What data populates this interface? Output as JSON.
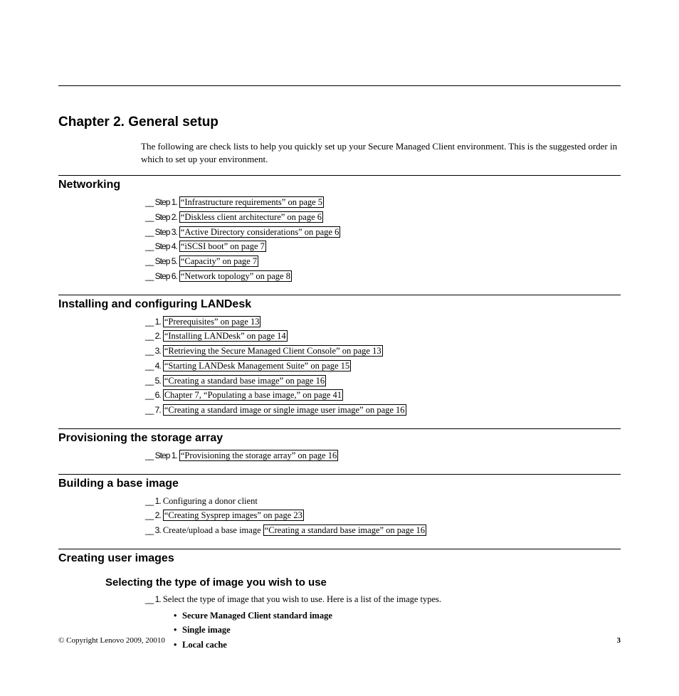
{
  "chapter_title": "Chapter 2. General setup",
  "intro": "The following are check lists to help you quickly set up your Secure Managed Client environment. This is the suggested order in which to set up your environment.",
  "sections": {
    "networking": {
      "heading": "Networking",
      "steps": [
        {
          "prefix": "__ Step 1.",
          "link": "“Infrastructure requirements” on page 5"
        },
        {
          "prefix": "__ Step 2.",
          "link": "“Diskless client architecture” on page 6"
        },
        {
          "prefix": "__ Step 3.",
          "link": "“Active Directory considerations” on page 6"
        },
        {
          "prefix": "__ Step 4.",
          "link": "“iSCSI boot” on page 7"
        },
        {
          "prefix": "__ Step 5.",
          "link": "“Capacity” on page 7"
        },
        {
          "prefix": "__ Step 6.",
          "link": "“Network topology” on page 8"
        }
      ]
    },
    "landesk": {
      "heading": "Installing and configuring LANDesk",
      "steps": [
        {
          "prefix": "__ 1.",
          "link": "“Prerequisites” on page 13"
        },
        {
          "prefix": "__ 2.",
          "link": "“Installing LANDesk” on page 14"
        },
        {
          "prefix": "__ 3.",
          "link": "“Retrieving the Secure Managed Client Console” on page 13"
        },
        {
          "prefix": "__ 4.",
          "link": "“Starting LANDesk Management Suite” on page 15"
        },
        {
          "prefix": "__ 5.",
          "link": "“Creating a standard base image” on page 16"
        },
        {
          "prefix": "__ 6.",
          "link": "Chapter 7, “Populating a base image,” on page 41"
        },
        {
          "prefix": "__ 7.",
          "link": "“Creating a standard image or single image user image” on page 16"
        }
      ]
    },
    "provisioning": {
      "heading": "Provisioning the storage array",
      "steps": [
        {
          "prefix": "__ Step 1.",
          "link": "“Provisioning the storage array” on page 16"
        }
      ]
    },
    "building": {
      "heading": "Building a base image",
      "steps": [
        {
          "prefix": "__ 1.",
          "text": "Configuring a donor client"
        },
        {
          "prefix": "__ 2.",
          "link": "“Creating Sysprep images” on page 23"
        },
        {
          "prefix": "__ 3.",
          "text": "Create/upload a base image ",
          "link": "“Creating a standard base image” on page 16"
        }
      ]
    },
    "creating": {
      "heading": "Creating user images",
      "sub_heading": "Selecting the type of image you wish to use",
      "item_prefix": "__ 1.",
      "item_text": "Select the type of image that you wish to use. Here is a list of the image types.",
      "bullets": [
        "Secure Managed Client standard image",
        "Single image",
        "Local cache"
      ]
    }
  },
  "footer": {
    "copyright": "© Copyright Lenovo 2009, 20010",
    "page": "3"
  }
}
